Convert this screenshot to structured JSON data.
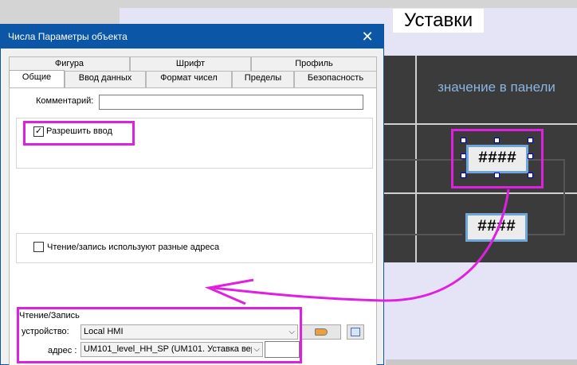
{
  "background": {
    "title": "Уставки",
    "panel_header": "значение в панели",
    "field1_value": "####",
    "field2_value": "####"
  },
  "dialog": {
    "title": "Числа Параметры объекта",
    "close_glyph": "✕",
    "tabs_row1": [
      "Фигура",
      "Шрифт",
      "Профиль"
    ],
    "tabs_row2": [
      "Общие",
      "Ввод данных",
      "Формат чисел",
      "Пределы",
      "Безопасность"
    ],
    "active_tab": "Общие",
    "comment_label": "Комментарий:",
    "comment_value": "",
    "allow_input": {
      "label": "Разрешить ввод",
      "checked": true,
      "check_glyph": "✓"
    },
    "rw_diff": {
      "label": "Чтение/запись используют разные адреса",
      "checked": false
    },
    "rw_group": {
      "title": "Чтение/Запись",
      "device_label": "устройство:",
      "device_value": "Local HMI",
      "address_label": "адрес :",
      "address_value": "UM101_level_HH_SP (UM101. Уставка вер",
      "address_extra": ""
    },
    "combo_arrow": "⌵"
  },
  "colors": {
    "titlebar": "#0b56a7",
    "highlight": "#e020e0",
    "panel_bg": "#3b3b3b",
    "panel_text": "#8ab4e2"
  }
}
